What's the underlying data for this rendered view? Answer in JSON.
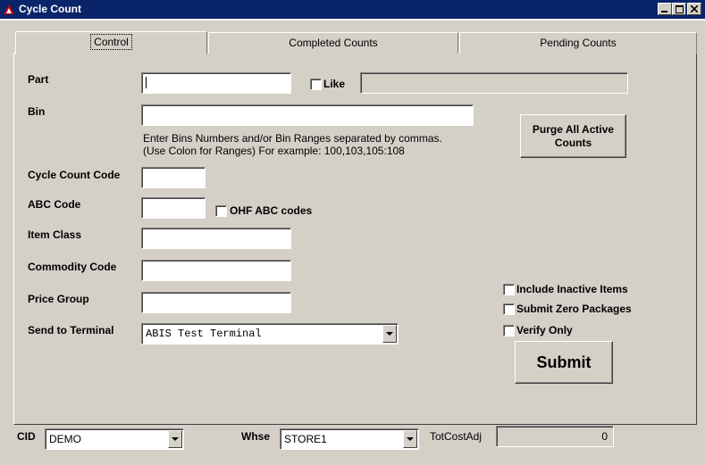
{
  "window": {
    "title": "Cycle Count"
  },
  "tabs": [
    {
      "label": "Control"
    },
    {
      "label": "Completed Counts"
    },
    {
      "label": "Pending Counts"
    }
  ],
  "form": {
    "part_label": "Part",
    "part_value": "",
    "like_label": "Like",
    "like_value": "",
    "bin_label": "Bin",
    "bin_value": "",
    "bin_hint_line1": "Enter Bins Numbers and/or Bin Ranges separated by commas.",
    "bin_hint_line2": "(Use Colon for Ranges)  For example: 100,103,105:108",
    "purge_label": "Purge All Active Counts",
    "cycle_count_code_label": "Cycle Count Code",
    "cycle_count_code_value": "",
    "abc_code_label": "ABC Code",
    "abc_code_value": "",
    "ohf_abc_label": "OHF ABC codes",
    "item_class_label": "Item Class",
    "item_class_value": "",
    "commodity_code_label": "Commodity Code",
    "commodity_code_value": "",
    "price_group_label": "Price Group",
    "price_group_value": "",
    "send_to_terminal_label": "Send to Terminal",
    "send_to_terminal_value": "ABIS Test Terminal",
    "include_inactive_label": "Include Inactive Items",
    "submit_zero_label": "Submit Zero Packages",
    "verify_only_label": "Verify Only",
    "submit_label": "Submit"
  },
  "footer": {
    "cid_label": "CID",
    "cid_value": "DEMO",
    "whse_label": "Whse",
    "whse_value": "STORE1",
    "totcostadj_label": "TotCostAdj",
    "totcostadj_value": "0"
  },
  "colors": {
    "titlebar": "#0a246a",
    "face": "#d4d0c8"
  }
}
